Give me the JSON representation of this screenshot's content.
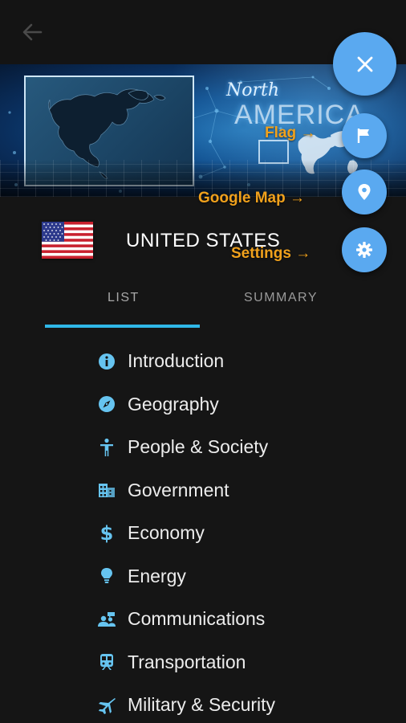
{
  "banner": {
    "region_line1": "North",
    "region_line2": "AMERICA"
  },
  "country": {
    "name": "UNITED STATES",
    "flag_icon": "us-flag-icon"
  },
  "tabs": [
    {
      "label": "LIST",
      "active": true
    },
    {
      "label": "SUMMARY",
      "active": false
    }
  ],
  "menu": {
    "items": [
      {
        "label": "Introduction",
        "icon": "info-icon"
      },
      {
        "label": "Geography",
        "icon": "compass-icon"
      },
      {
        "label": "People & Society",
        "icon": "person-icon"
      },
      {
        "label": "Government",
        "icon": "building-icon"
      },
      {
        "label": "Economy",
        "icon": "dollar-icon"
      },
      {
        "label": "Energy",
        "icon": "lightbulb-icon"
      },
      {
        "label": "Communications",
        "icon": "people-chat-icon"
      },
      {
        "label": "Transportation",
        "icon": "train-icon"
      },
      {
        "label": "Military & Security",
        "icon": "jet-icon"
      }
    ]
  },
  "fab": {
    "main_icon": "close-icon",
    "flag_label": "Flag →",
    "map_label": "Google Map →",
    "settings_label": "Settings →"
  },
  "colors": {
    "accent": "#2fb7e8",
    "fab": "#5aa9f0",
    "hint_label": "#f0a11c",
    "icon": "#66c4f0",
    "background": "#151515"
  }
}
